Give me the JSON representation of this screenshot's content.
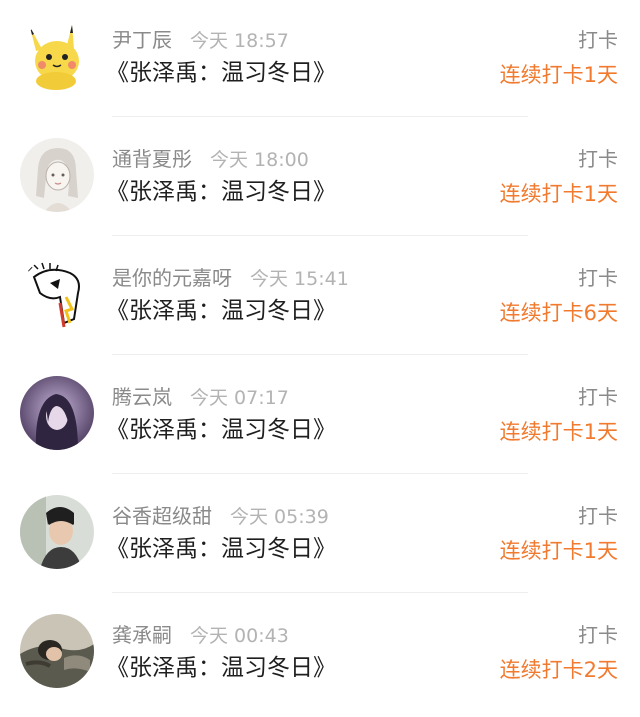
{
  "feed": {
    "items": [
      {
        "username": "尹丁辰",
        "time": "今天 18:57",
        "title": "《张泽禹：温习冬日》",
        "action": "打卡",
        "streak": "连续打卡1天",
        "avatar": "pikachu-avatar"
      },
      {
        "username": "通背夏彤",
        "time": "今天 18:00",
        "title": "《张泽禹：温习冬日》",
        "action": "打卡",
        "streak": "连续打卡1天",
        "avatar": "sketch-girl-avatar"
      },
      {
        "username": "是你的元嘉呀",
        "time": "今天 15:41",
        "title": "《张泽禹：温习冬日》",
        "action": "打卡",
        "streak": "连续打卡6天",
        "avatar": "cartoon-bird-avatar"
      },
      {
        "username": "腾云岚",
        "time": "今天 07:17",
        "title": "《张泽禹：温习冬日》",
        "action": "打卡",
        "streak": "连续打卡1天",
        "avatar": "purple-photo-avatar"
      },
      {
        "username": "谷香超级甜",
        "time": "今天 05:39",
        "title": "《张泽禹：温习冬日》",
        "action": "打卡",
        "streak": "连续打卡1天",
        "avatar": "boy-photo-avatar"
      },
      {
        "username": "龚承嗣",
        "time": "今天 00:43",
        "title": "《张泽禹：温习冬日》",
        "action": "打卡",
        "streak": "连续打卡2天",
        "avatar": "lying-person-avatar"
      }
    ]
  },
  "colors": {
    "accent": "#f17a2e",
    "meta": "#8a8a8a",
    "time": "#b3b3b3",
    "title": "#1f1f1f",
    "divider": "#eeeeee"
  }
}
